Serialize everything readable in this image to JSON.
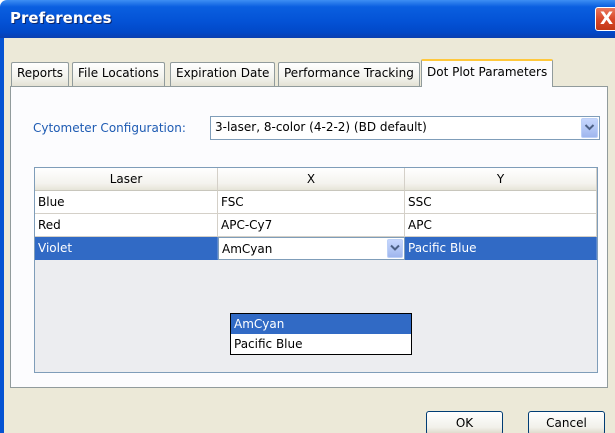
{
  "window": {
    "title": "Preferences",
    "close_glyph": "X"
  },
  "tabs": [
    {
      "label": "Reports",
      "active": false
    },
    {
      "label": "File Locations",
      "active": false
    },
    {
      "label": "Expiration Date",
      "active": false
    },
    {
      "label": "Performance Tracking",
      "active": false
    },
    {
      "label": "Dot Plot Parameters",
      "active": true
    }
  ],
  "cytometer": {
    "label": "Cytometer Configuration:",
    "value": "3-laser, 8-color (4-2-2) (BD default)",
    "dropdown_icon": "chevron-down-icon"
  },
  "grid": {
    "headers": [
      "Laser",
      "X",
      "Y"
    ],
    "rows": [
      {
        "laser": "Blue",
        "x": "FSC",
        "y": "SSC",
        "selected": false
      },
      {
        "laser": "Red",
        "x": "APC-Cy7",
        "y": "APC",
        "selected": false
      },
      {
        "laser": "Violet",
        "x": "AmCyan",
        "y": "Pacific Blue",
        "selected": true
      }
    ],
    "x_dropdown": {
      "options": [
        "AmCyan",
        "Pacific Blue"
      ],
      "highlighted": "AmCyan"
    }
  },
  "buttons": {
    "ok": "OK",
    "cancel": "Cancel"
  },
  "colors": {
    "title_bar": "#0453d6",
    "selection": "#316ac5",
    "label_blue": "#1e5bb3",
    "active_tab_accent": "#ffc83c",
    "close_button": "#d9492b"
  }
}
